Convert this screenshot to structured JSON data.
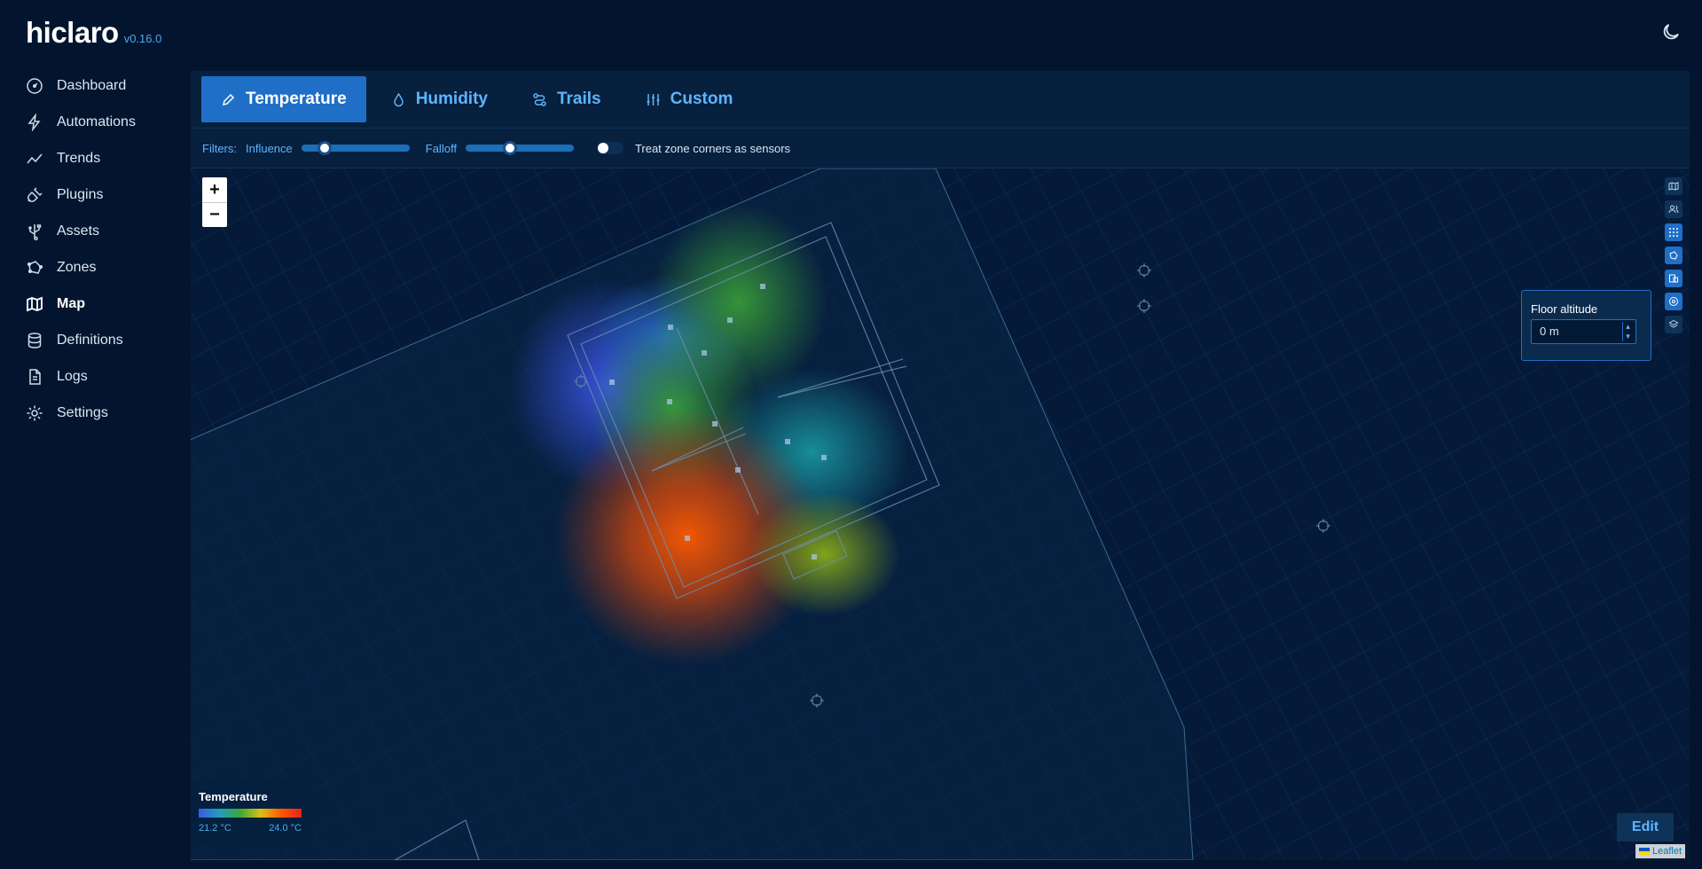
{
  "app": {
    "name": "hiclaro",
    "version": "v0.16.0"
  },
  "nav": {
    "items": [
      {
        "label": "Dashboard",
        "icon": "dashboard-icon"
      },
      {
        "label": "Automations",
        "icon": "bolt-icon"
      },
      {
        "label": "Trends",
        "icon": "trend-icon"
      },
      {
        "label": "Plugins",
        "icon": "plug-icon"
      },
      {
        "label": "Assets",
        "icon": "usb-icon"
      },
      {
        "label": "Zones",
        "icon": "zone-icon"
      },
      {
        "label": "Map",
        "icon": "map-icon"
      },
      {
        "label": "Definitions",
        "icon": "database-icon"
      },
      {
        "label": "Logs",
        "icon": "file-icon"
      },
      {
        "label": "Settings",
        "icon": "gear-icon"
      }
    ],
    "active": "Map"
  },
  "tabs": [
    {
      "label": "Temperature",
      "icon": "pen-icon",
      "active": true
    },
    {
      "label": "Humidity",
      "icon": "drop-icon",
      "active": false
    },
    {
      "label": "Trails",
      "icon": "route-icon",
      "active": false
    },
    {
      "label": "Custom",
      "icon": "sliders-icon",
      "active": false
    }
  ],
  "filters": {
    "label": "Filters:",
    "influence": {
      "label": "Influence",
      "value": 0.17
    },
    "falloff": {
      "label": "Falloff",
      "value": 0.4
    },
    "corners": {
      "label": "Treat zone corners as sensors",
      "enabled": false
    }
  },
  "map": {
    "zoom_in": "+",
    "zoom_out": "−",
    "altitude": {
      "title": "Floor altitude",
      "value": "0 m"
    },
    "legend": {
      "title": "Temperature",
      "min": "21.2 °C",
      "max": "24.0 °C"
    },
    "edit_label": "Edit",
    "attribution": "Leaflet"
  },
  "colors": {
    "accent": "#1f6fc6",
    "link": "#5fb4ff",
    "background": "#03152e"
  }
}
